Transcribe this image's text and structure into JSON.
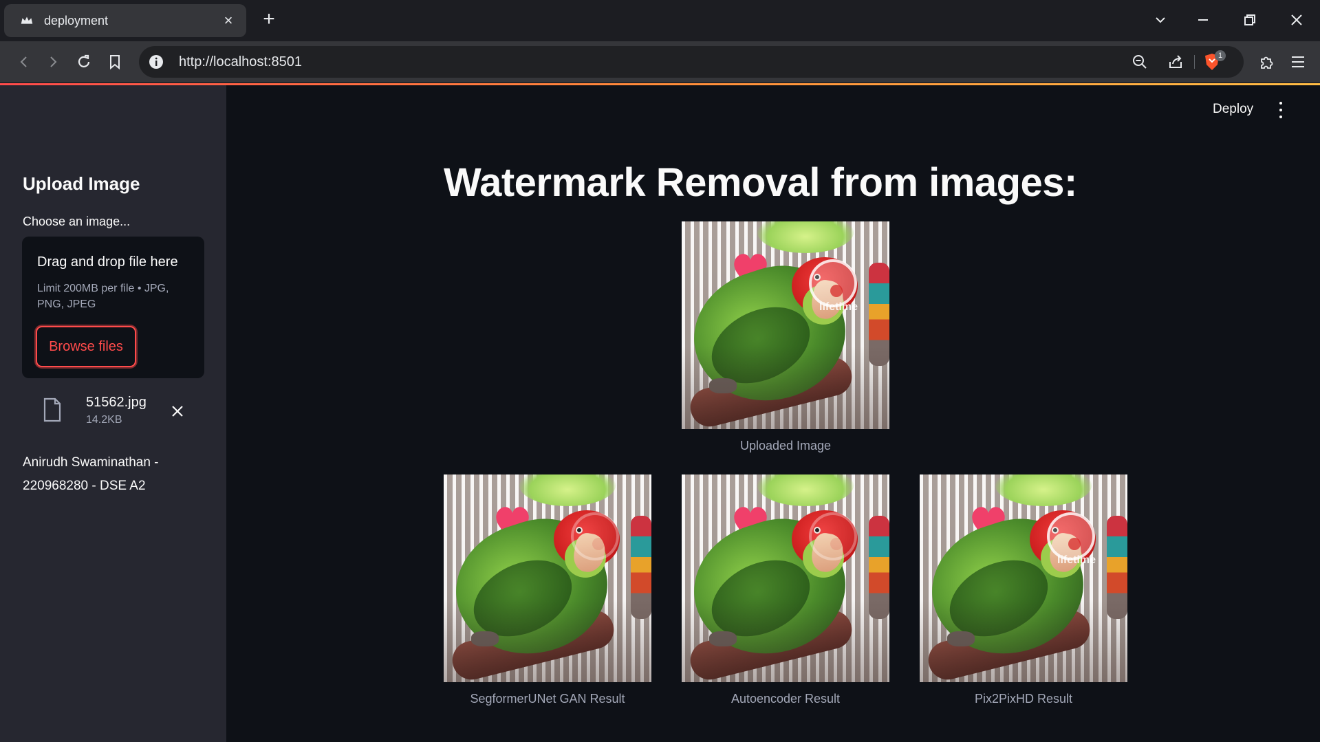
{
  "browser": {
    "tab_title": "deployment",
    "url": "http://localhost:8501",
    "extension_badge": "1"
  },
  "sidebar": {
    "heading": "Upload Image",
    "uploader_label": "Choose an image...",
    "dropzone_title": "Drag and drop file here",
    "dropzone_limit": "Limit 200MB per file • JPG, PNG, JPEG",
    "browse_label": "Browse files",
    "file_name": "51562.jpg",
    "file_size": "14.2KB",
    "author": "Anirudh Swaminathan - 220968280 - DSE A2"
  },
  "header": {
    "deploy_label": "Deploy"
  },
  "main": {
    "title": "Watermark Removal from images:",
    "uploaded_caption": "Uploaded Image",
    "results": [
      {
        "caption": "SegformerUNet GAN Result"
      },
      {
        "caption": "Autoencoder Result"
      },
      {
        "caption": "Pix2PixHD Result"
      }
    ],
    "watermark_text": "lifetime"
  },
  "colors": {
    "accent": "#ff4b4b",
    "sidebar_bg": "#262730",
    "main_bg": "#0e1117",
    "chrome_bg": "#35363a"
  }
}
